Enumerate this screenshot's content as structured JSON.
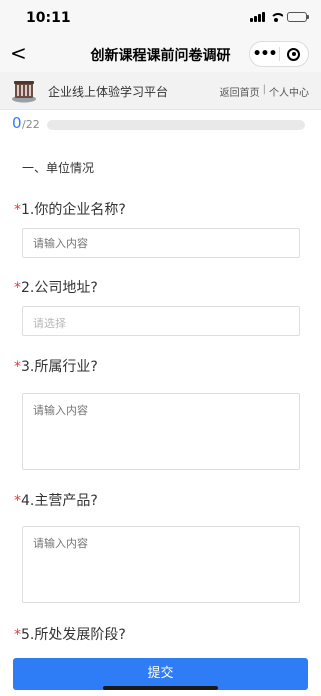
{
  "status_bar": {
    "time": "10:11"
  },
  "nav": {
    "back_glyph": "<",
    "title": "创新课程课前问卷调研",
    "more_glyph": "•••"
  },
  "platform": {
    "name": "企业线上体验学习平台",
    "links": [
      "返回首页",
      "个人中心"
    ],
    "separator": "|"
  },
  "progress": {
    "current": "0",
    "total": "/22",
    "fraction": 0
  },
  "section": {
    "title": "一、单位情况"
  },
  "questions": [
    {
      "required_mark": "*",
      "title": "1.你的企业名称?",
      "placeholder": "请输入内容"
    },
    {
      "required_mark": "*",
      "title": "2.公司地址?",
      "placeholder": "请选择"
    },
    {
      "required_mark": "*",
      "title": "3.所属行业?",
      "placeholder": "请输入内容"
    },
    {
      "required_mark": "*",
      "title": "4.主营产品?",
      "placeholder": "请输入内容"
    },
    {
      "required_mark": "*",
      "title": "5.所处发展阶段?"
    }
  ],
  "submit": {
    "label": "提交"
  },
  "colors": {
    "accent": "#2e7cf6",
    "required": "#e53935"
  }
}
